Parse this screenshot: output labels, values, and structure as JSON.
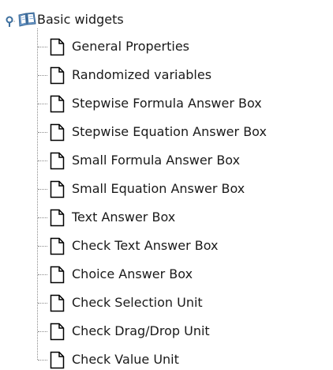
{
  "tree": {
    "root": {
      "label": "Basic widgets",
      "icon": "open-book-icon",
      "expanded": true
    },
    "items": [
      {
        "label": "General Properties",
        "icon": "document-icon"
      },
      {
        "label": "Randomized variables",
        "icon": "document-icon"
      },
      {
        "label": "Stepwise Formula Answer Box",
        "icon": "document-icon"
      },
      {
        "label": "Stepwise Equation Answer Box",
        "icon": "document-icon"
      },
      {
        "label": "Small Formula Answer Box",
        "icon": "document-icon"
      },
      {
        "label": "Small Equation Answer Box",
        "icon": "document-icon"
      },
      {
        "label": "Text Answer Box",
        "icon": "document-icon"
      },
      {
        "label": "Check Text Answer Box",
        "icon": "document-icon"
      },
      {
        "label": "Choice Answer Box",
        "icon": "document-icon"
      },
      {
        "label": "Check Selection Unit",
        "icon": "document-icon"
      },
      {
        "label": "Check Drag/Drop Unit",
        "icon": "document-icon"
      },
      {
        "label": "Check Value Unit",
        "icon": "document-icon"
      }
    ]
  },
  "colors": {
    "handle": "#3d6f9e",
    "book_cover": "#7aa6d6",
    "book_page": "#ffffff",
    "book_outline": "#2f5f8f",
    "doc_outline": "#000000",
    "connector": "#8a8a8a",
    "text": "#1a1a1a"
  }
}
